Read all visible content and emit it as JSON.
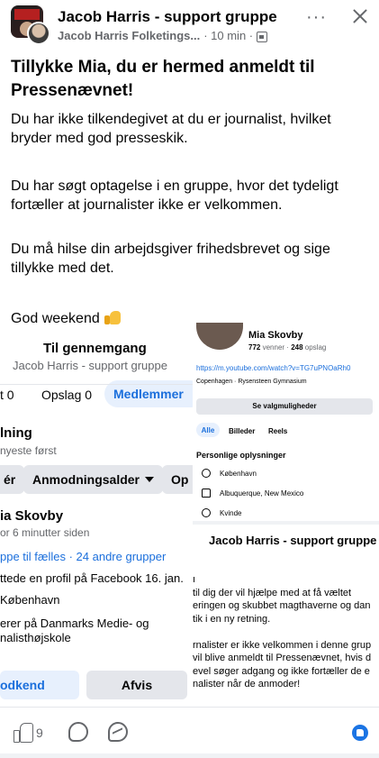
{
  "header": {
    "group_name": "Jacob Harris - support gruppe",
    "author": "Jacob Harris Folketings...",
    "time": "· 10 min ·",
    "more": "···"
  },
  "post": {
    "title": "Tillykke Mia, du er hermed anmeldt til Pressenævnet!",
    "paragraphs": [
      "Du har ikke tilkendegivet at du er journalist, hvilket bryder med god presseskik.",
      "Du har søgt optagelse i en gruppe, hvor det tydeligt fortæller at journalister ikke er velkommen.",
      "Du må hilse din arbejdsgiver frihedsbrevet og sige tillykke med det.",
      "God weekend"
    ]
  },
  "left_shot": {
    "title": "Til gennemgang",
    "subtitle": "Jacob Harris - support gruppe",
    "tab_partial": "t 0",
    "tab_posts": "Opslag 0",
    "tab_members": "Medlemmer",
    "heading": "lning",
    "sort": "nyeste først",
    "chip_left": "ér",
    "chip_middle": "Anmodningsalder",
    "chip_right": "Op",
    "member_name": "ia Skovby",
    "time": "or 6 minutter siden",
    "groups": "ppe til fælles · 24 andre grupper",
    "line1": "ttede en profil på Facebook 16. jan.",
    "line2": "København",
    "line3": "erer på Danmarks Medie- og",
    "line4": "nalisthøjskole",
    "approve": "odkend",
    "reject": "Afvis"
  },
  "right_shot": {
    "name": "Mia Skovby",
    "friends": "772",
    "friends_label": "venner ·",
    "posts": "248",
    "posts_label": "opslag",
    "link": "https://m.youtube.com/watch?v=TG7uPNOaRh0",
    "location": "Copenhagen · Rysensteen Gymnasium",
    "options_button": "Se valgmuligheder",
    "tabs": [
      "Alle",
      "Billeder",
      "Reels"
    ],
    "personal_heading": "Personlige oplysninger",
    "info": [
      "København",
      "Albuquerque, New Mexico",
      "Kvinde"
    ],
    "group_name": "Jacob Harris - support gruppe",
    "text_lines": [
      "ı",
      "til dig der vil hjælpe med at få væltet",
      "eringen og skubbet magthaverne og dan",
      "tik i en ny retning.",
      "",
      "rnalister er ikke velkommen i denne grup",
      "vil blive anmeldt til Pressenævnet, hvis d",
      "evel søger adgang og ikke fortæller de e",
      "nalister når de anmoder!"
    ]
  },
  "footer": {
    "like_count": "9"
  },
  "colors": {
    "accent": "#1b6fdc",
    "muted": "#65676b",
    "chip_bg": "#e4e6eb",
    "accent_bg": "#e7f0fd"
  }
}
